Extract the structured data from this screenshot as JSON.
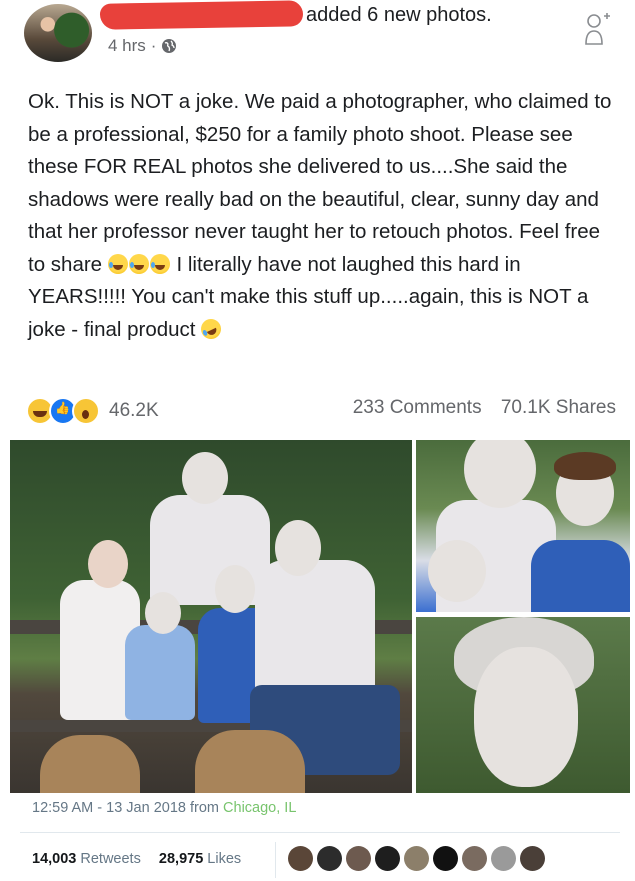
{
  "post": {
    "author_action": "added 6 new photos.",
    "timestamp": "4 hrs",
    "separator": "·",
    "paragraph": [
      "Ok.  This is NOT a joke.  We paid a photographer, who claimed to be a professional, $250 for a family photo shoot.  Please see these FOR REAL photos she delivered to us....She said the shadows were really bad on the beautiful, clear, sunny day and that her professor never taught her to retouch photos.  Feel free to share ",
      " I literally have not laughed this hard in YEARS!!!!!  You can't make this stuff up.....again, this is NOT a joke - final product "
    ],
    "reaction_count": "46.2K",
    "comments": "233 Comments",
    "shares": "70.1K Shares",
    "icons": [
      "avatar",
      "globe-icon",
      "follow-friend-icon",
      "haha-reaction-icon",
      "like-reaction-icon",
      "wow-reaction-icon",
      "tears-of-joy-emoji",
      "rofl-emoji"
    ]
  },
  "tweet": {
    "time": "12:59 AM - 13 Jan 2018 from ",
    "location": "Chicago, IL",
    "retweets_count": "14,003",
    "retweets_label": "Retweets",
    "likes_count": "28,975",
    "likes_label": "Likes"
  },
  "colors": {
    "link_green": "#78c46d",
    "muted": "#657786",
    "like_blue": "#1877f2",
    "redaction_red": "#e8413b"
  }
}
